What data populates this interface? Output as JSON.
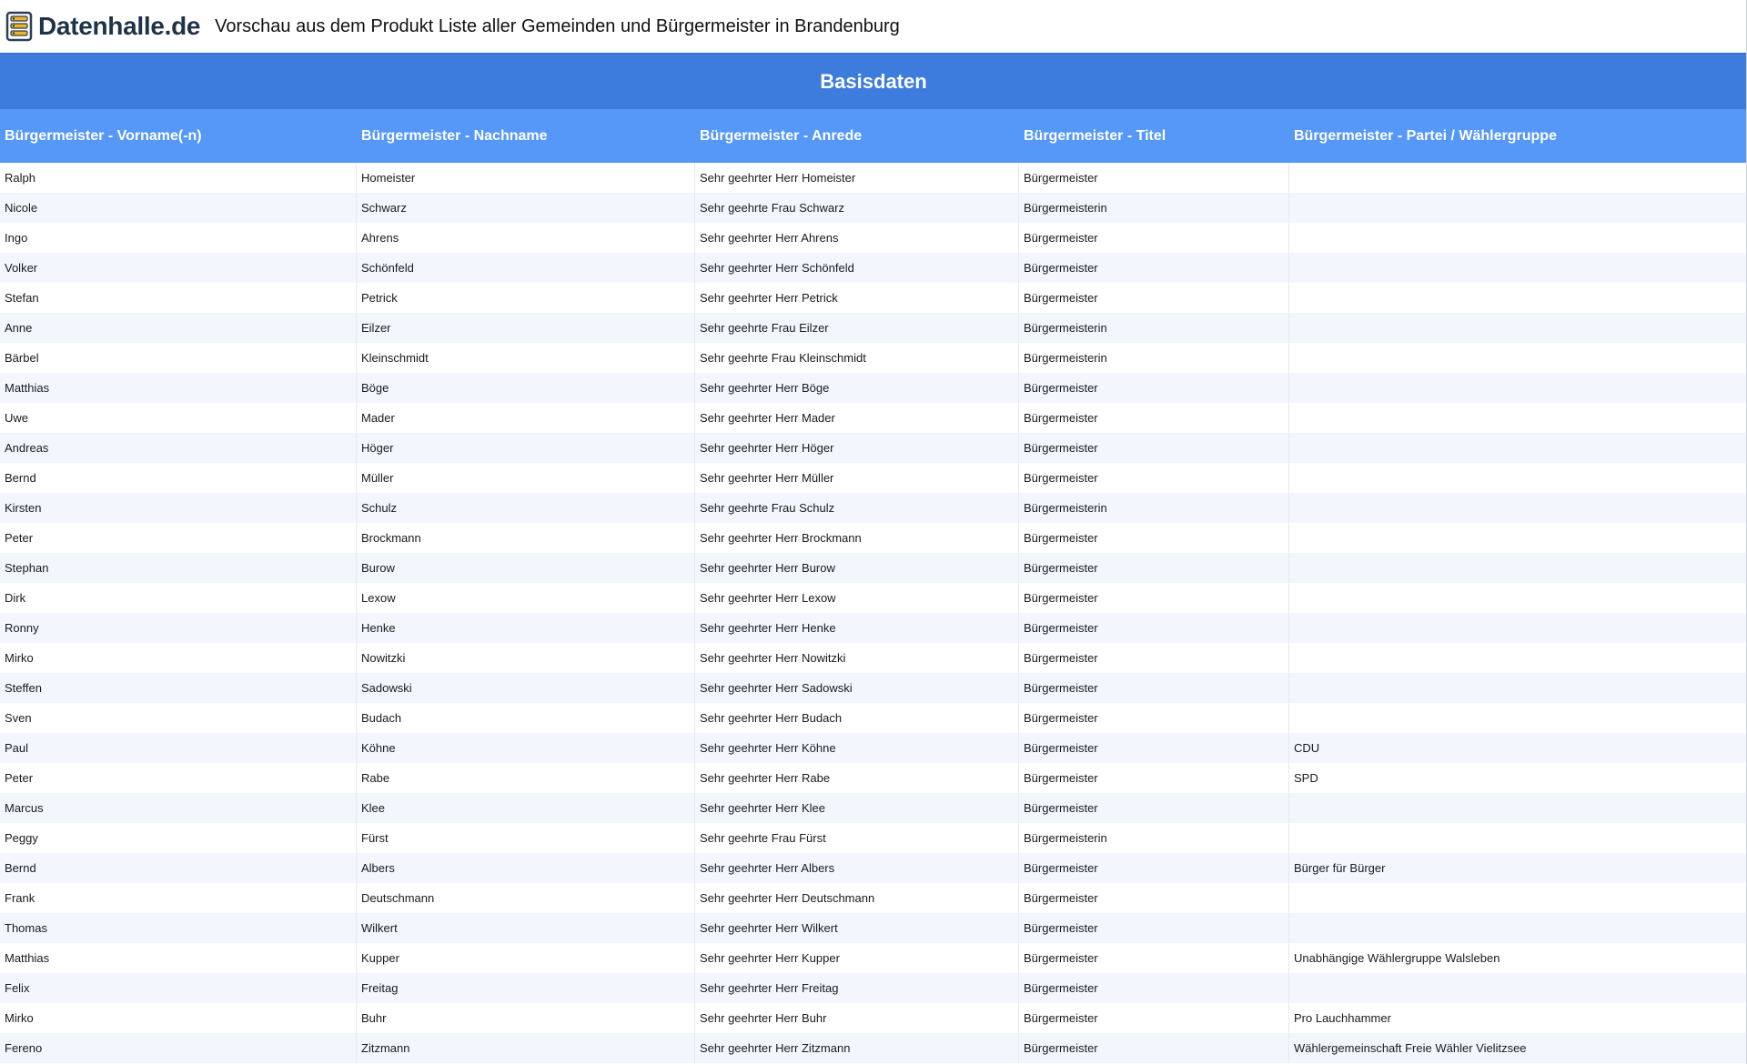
{
  "header": {
    "brand": "Datenhalle.de",
    "title": "Vorschau aus dem Produkt Liste aller Gemeinden und Bürgermeister in Brandenburg"
  },
  "section": {
    "title": "Basisdaten"
  },
  "table": {
    "columns": [
      "Bürgermeister - Vorname(-n)",
      "Bürgermeister - Nachname",
      "Bürgermeister - Anrede",
      "Bürgermeister - Titel",
      "Bürgermeister - Partei / Wählergruppe"
    ],
    "rows": [
      [
        "Ralph",
        "Homeister",
        "Sehr geehrter Herr Homeister",
        "Bürgermeister",
        ""
      ],
      [
        "Nicole",
        "Schwarz",
        "Sehr geehrte Frau Schwarz",
        "Bürgermeisterin",
        ""
      ],
      [
        "Ingo",
        "Ahrens",
        "Sehr geehrter Herr Ahrens",
        "Bürgermeister",
        ""
      ],
      [
        "Volker",
        "Schönfeld",
        "Sehr geehrter Herr Schönfeld",
        "Bürgermeister",
        ""
      ],
      [
        "Stefan",
        "Petrick",
        "Sehr geehrter Herr Petrick",
        "Bürgermeister",
        ""
      ],
      [
        "Anne",
        "Eilzer",
        "Sehr geehrte Frau Eilzer",
        "Bürgermeisterin",
        ""
      ],
      [
        "Bärbel",
        "Kleinschmidt",
        "Sehr geehrte Frau Kleinschmidt",
        "Bürgermeisterin",
        ""
      ],
      [
        "Matthias",
        "Böge",
        "Sehr geehrter Herr Böge",
        "Bürgermeister",
        ""
      ],
      [
        "Uwe",
        "Mader",
        "Sehr geehrter Herr Mader",
        "Bürgermeister",
        ""
      ],
      [
        "Andreas",
        "Höger",
        "Sehr geehrter Herr Höger",
        "Bürgermeister",
        ""
      ],
      [
        "Bernd",
        "Müller",
        "Sehr geehrter Herr Müller",
        "Bürgermeister",
        ""
      ],
      [
        "Kirsten",
        "Schulz",
        "Sehr geehrte Frau Schulz",
        "Bürgermeisterin",
        ""
      ],
      [
        "Peter",
        "Brockmann",
        "Sehr geehrter Herr Brockmann",
        "Bürgermeister",
        ""
      ],
      [
        "Stephan",
        "Burow",
        "Sehr geehrter Herr Burow",
        "Bürgermeister",
        ""
      ],
      [
        "Dirk",
        "Lexow",
        "Sehr geehrter Herr Lexow",
        "Bürgermeister",
        ""
      ],
      [
        "Ronny",
        "Henke",
        "Sehr geehrter Herr Henke",
        "Bürgermeister",
        ""
      ],
      [
        "Mirko",
        "Nowitzki",
        "Sehr geehrter Herr Nowitzki",
        "Bürgermeister",
        ""
      ],
      [
        "Steffen",
        "Sadowski",
        "Sehr geehrter Herr Sadowski",
        "Bürgermeister",
        ""
      ],
      [
        "Sven",
        "Budach",
        "Sehr geehrter Herr Budach",
        "Bürgermeister",
        ""
      ],
      [
        "Paul",
        "Köhne",
        "Sehr geehrter Herr Köhne",
        "Bürgermeister",
        "CDU"
      ],
      [
        "Peter",
        "Rabe",
        "Sehr geehrter Herr Rabe",
        "Bürgermeister",
        "SPD"
      ],
      [
        "Marcus",
        "Klee",
        "Sehr geehrter Herr Klee",
        "Bürgermeister",
        ""
      ],
      [
        "Peggy",
        "Fürst",
        "Sehr geehrte Frau Fürst",
        "Bürgermeisterin",
        ""
      ],
      [
        "Bernd",
        "Albers",
        "Sehr geehrter Herr Albers",
        "Bürgermeister",
        "Bürger für Bürger"
      ],
      [
        "Frank",
        "Deutschmann",
        "Sehr geehrter Herr Deutschmann",
        "Bürgermeister",
        ""
      ],
      [
        "Thomas",
        "Wilkert",
        "Sehr geehrter Herr Wilkert",
        "Bürgermeister",
        ""
      ],
      [
        "Matthias",
        "Kupper",
        "Sehr geehrter Herr Kupper",
        "Bürgermeister",
        "Unabhängige Wählergruppe Walsleben"
      ],
      [
        "Felix",
        "Freitag",
        "Sehr geehrter Herr Freitag",
        "Bürgermeister",
        ""
      ],
      [
        "Mirko",
        "Buhr",
        "Sehr geehrter Herr Buhr",
        "Bürgermeister",
        "Pro Lauchhammer"
      ],
      [
        "Fereno",
        "Zitzmann",
        "Sehr geehrter Herr Zitzmann",
        "Bürgermeister",
        "Wählergemeinschaft Freie Wähler Vielitzsee"
      ]
    ]
  }
}
